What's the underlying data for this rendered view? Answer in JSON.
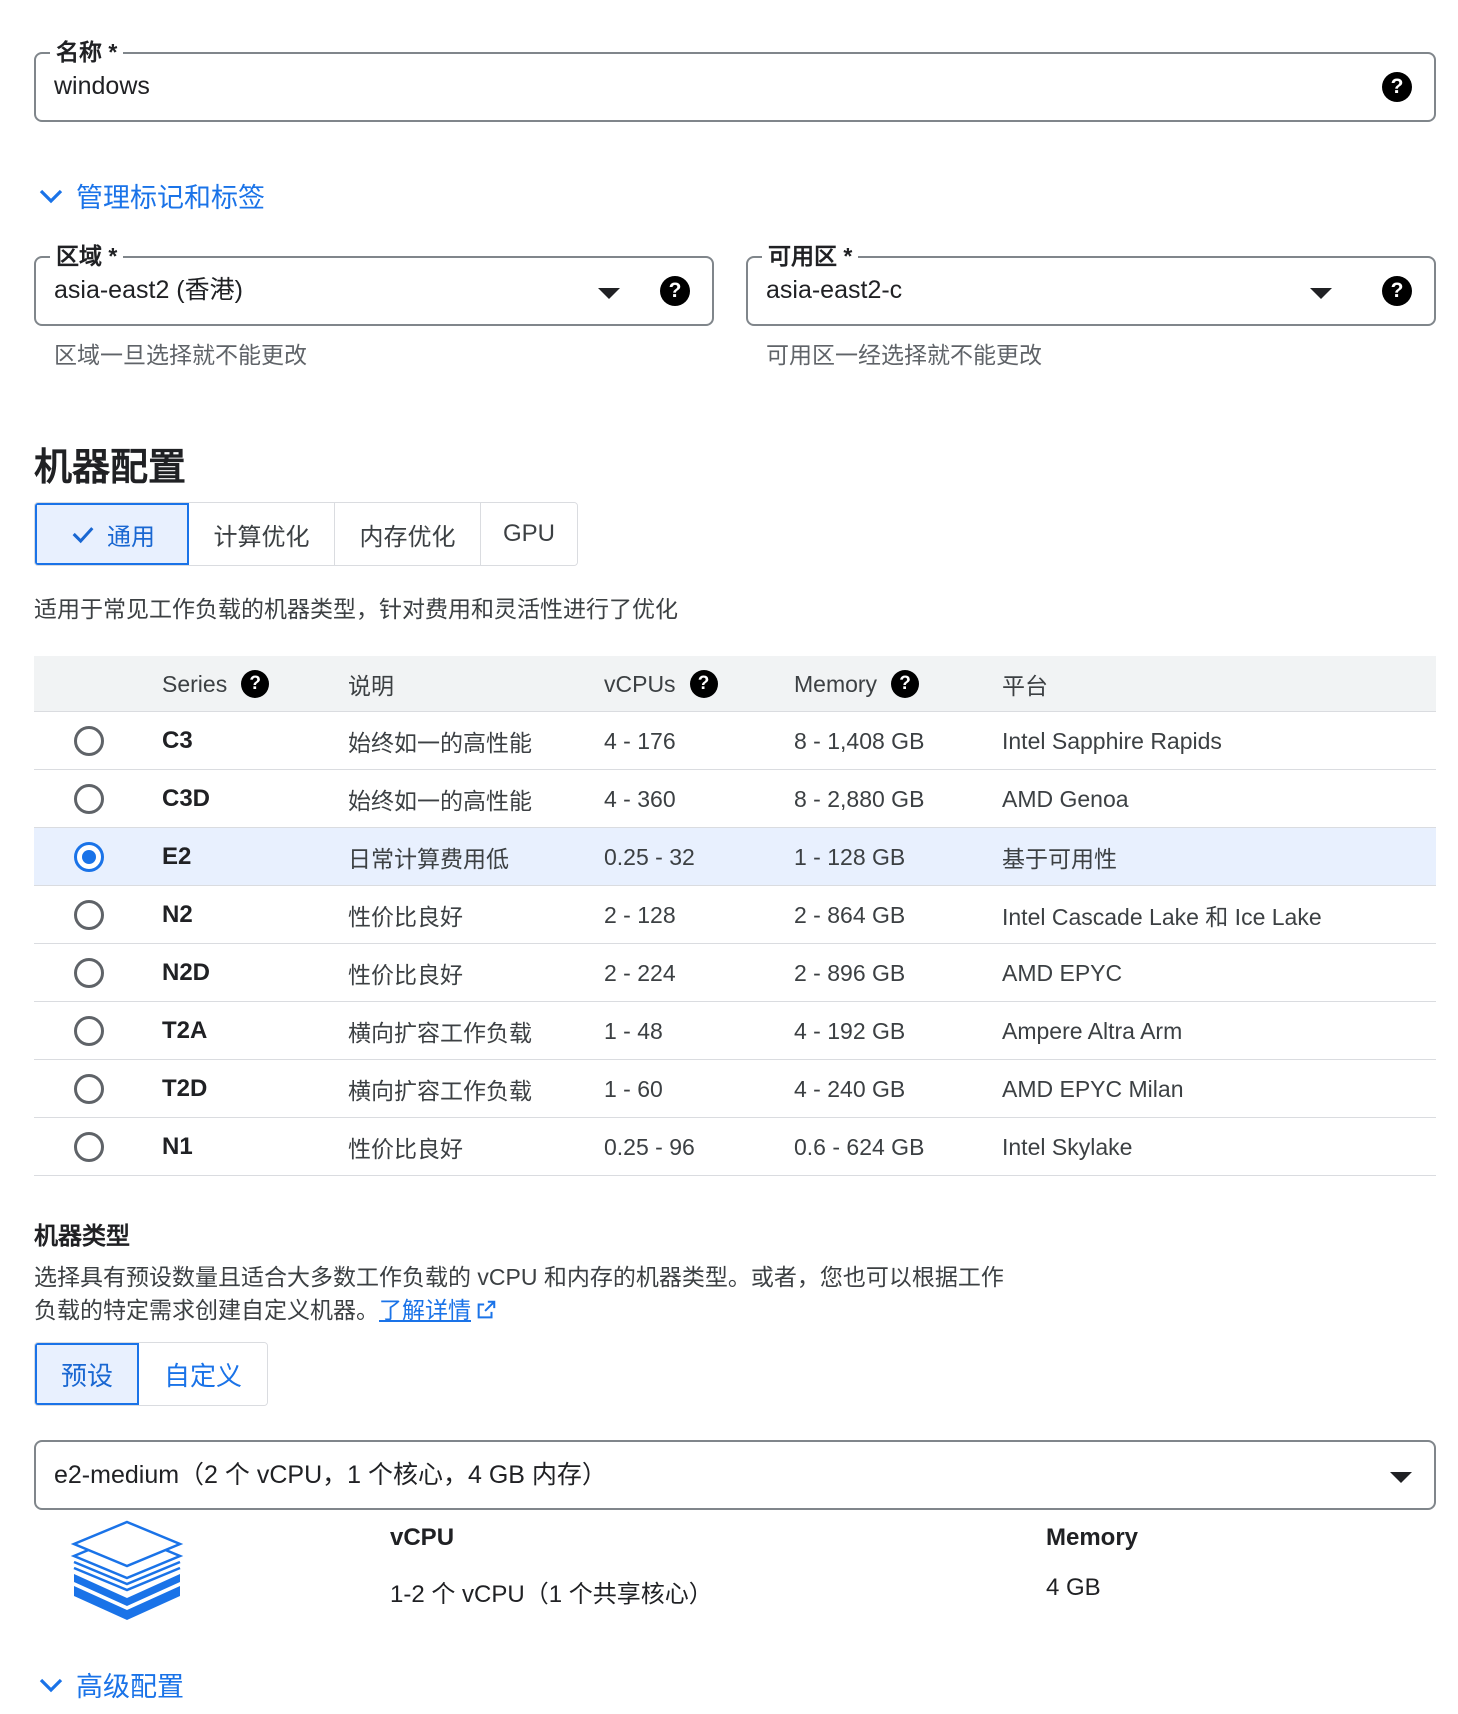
{
  "name_field": {
    "label": "名称 *",
    "value": "windows"
  },
  "labels_toggle": {
    "label": "管理标记和标签"
  },
  "region_field": {
    "label": "区域 *",
    "value": "asia-east2 (香港)",
    "hint": "区域一旦选择就不能更改"
  },
  "zone_field": {
    "label": "可用区 *",
    "value": "asia-east2-c",
    "hint": "可用区一经选择就不能更改"
  },
  "machine_config": {
    "title": "机器配置",
    "tabs": [
      "通用",
      "计算优化",
      "内存优化",
      "GPU"
    ],
    "active_tab": "通用",
    "description": "适用于常见工作负载的机器类型，针对费用和灵活性进行了优化"
  },
  "series_table": {
    "headers": {
      "series": "Series",
      "description": "说明",
      "vcpus": "vCPUs",
      "memory": "Memory",
      "platform": "平台"
    },
    "rows": [
      {
        "series": "C3",
        "description": "始终如一的高性能",
        "vcpus": "4 - 176",
        "memory": "8 - 1,408 GB",
        "platform": "Intel Sapphire Rapids",
        "selected": false
      },
      {
        "series": "C3D",
        "description": "始终如一的高性能",
        "vcpus": "4 - 360",
        "memory": "8 - 2,880 GB",
        "platform": "AMD Genoa",
        "selected": false
      },
      {
        "series": "E2",
        "description": "日常计算费用低",
        "vcpus": "0.25 - 32",
        "memory": "1 - 128 GB",
        "platform": "基于可用性",
        "selected": true
      },
      {
        "series": "N2",
        "description": "性价比良好",
        "vcpus": "2 - 128",
        "memory": "2 - 864 GB",
        "platform": "Intel Cascade Lake 和 Ice Lake",
        "selected": false
      },
      {
        "series": "N2D",
        "description": "性价比良好",
        "vcpus": "2 - 224",
        "memory": "2 - 896 GB",
        "platform": "AMD EPYC",
        "selected": false
      },
      {
        "series": "T2A",
        "description": "横向扩容工作负载",
        "vcpus": "1 - 48",
        "memory": "4 - 192 GB",
        "platform": "Ampere Altra Arm",
        "selected": false
      },
      {
        "series": "T2D",
        "description": "横向扩容工作负载",
        "vcpus": "1 - 60",
        "memory": "4 - 240 GB",
        "platform": "AMD EPYC Milan",
        "selected": false
      },
      {
        "series": "N1",
        "description": "性价比良好",
        "vcpus": "0.25 - 96",
        "memory": "0.6 - 624 GB",
        "platform": "Intel Skylake",
        "selected": false
      }
    ]
  },
  "machine_type": {
    "title": "机器类型",
    "description_line1": "选择具有预设数量且适合大多数工作负载的 vCPU 和内存的机器类型。或者，您也可以根据工作",
    "description_line2": "负载的特定需求创建自定义机器。",
    "learn_more": "了解详情",
    "tabs": [
      "预设",
      "自定义"
    ],
    "active_tab": "预设",
    "selected_type": "e2-medium（2 个 vCPU，1 个核心，4 GB 内存）",
    "vcpu_label": "vCPU",
    "vcpu_value": "1-2 个 vCPU（1 个共享核心）",
    "memory_label": "Memory",
    "memory_value": "4 GB"
  },
  "advanced_toggle": {
    "label": "高级配置"
  },
  "colors": {
    "accent": "#1a73e8",
    "selected_bg": "#e8f0fe",
    "border": "#80868b",
    "header_bg": "#f1f3f4"
  },
  "icons": [
    "help-icon",
    "dropdown-arrow-icon",
    "chevron-down-icon",
    "check-icon",
    "external-link-icon",
    "machine-layers-icon"
  ]
}
